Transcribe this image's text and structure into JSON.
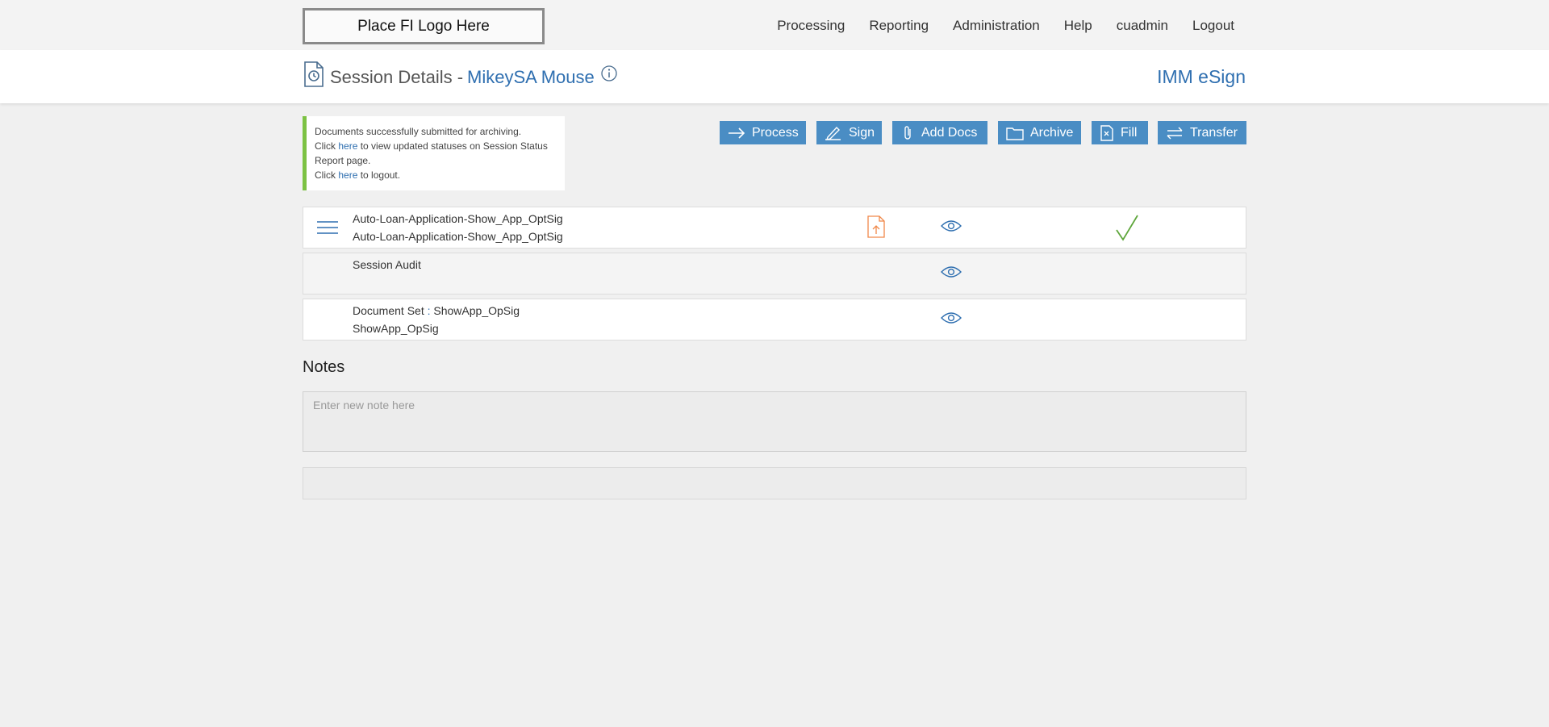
{
  "logo": {
    "text": "Place FI Logo Here"
  },
  "nav": {
    "items": [
      "Processing",
      "Reporting",
      "Administration",
      "Help",
      "cuadmin",
      "Logout"
    ]
  },
  "header": {
    "title": "Session Details -",
    "name": "MikeySA Mouse",
    "app_name": "IMM eSign"
  },
  "alert": {
    "line1": "Documents successfully submitted for archiving.",
    "line2_pre": "Click ",
    "line2_link": "here",
    "line2_post": " to view updated statuses on Session Status Report page.",
    "line3_pre": "Click ",
    "line3_link": "here",
    "line3_post": " to logout."
  },
  "actions": {
    "process": "Process",
    "sign": "Sign",
    "add_docs": "Add Docs",
    "archive": "Archive",
    "fill": "Fill",
    "transfer": "Transfer"
  },
  "documents": [
    {
      "line1": "Auto-Loan-Application-Show_App_OptSig",
      "line2": "Auto-Loan-Application-Show_App_OptSig"
    },
    {
      "line1": "Session Audit",
      "line2": ""
    },
    {
      "line1_pre": "Document Set",
      "line1_sep": " : ",
      "line1_post": "ShowApp_OpSig",
      "line2": "ShowApp_OpSig"
    }
  ],
  "notes": {
    "heading": "Notes",
    "placeholder": "Enter new note here"
  },
  "colors": {
    "accent": "#2f6fb0",
    "button": "#4a8dc4",
    "success": "#7cc243",
    "pdf": "#f0894a",
    "check": "#5ea63b"
  },
  "icons": {
    "header": "history-document-icon",
    "info": "info-icon",
    "row_menu": "hamburger-menu-icon",
    "row_pdf": "pdf-upload-icon",
    "row_view": "eye-icon",
    "row_status": "check-icon"
  }
}
